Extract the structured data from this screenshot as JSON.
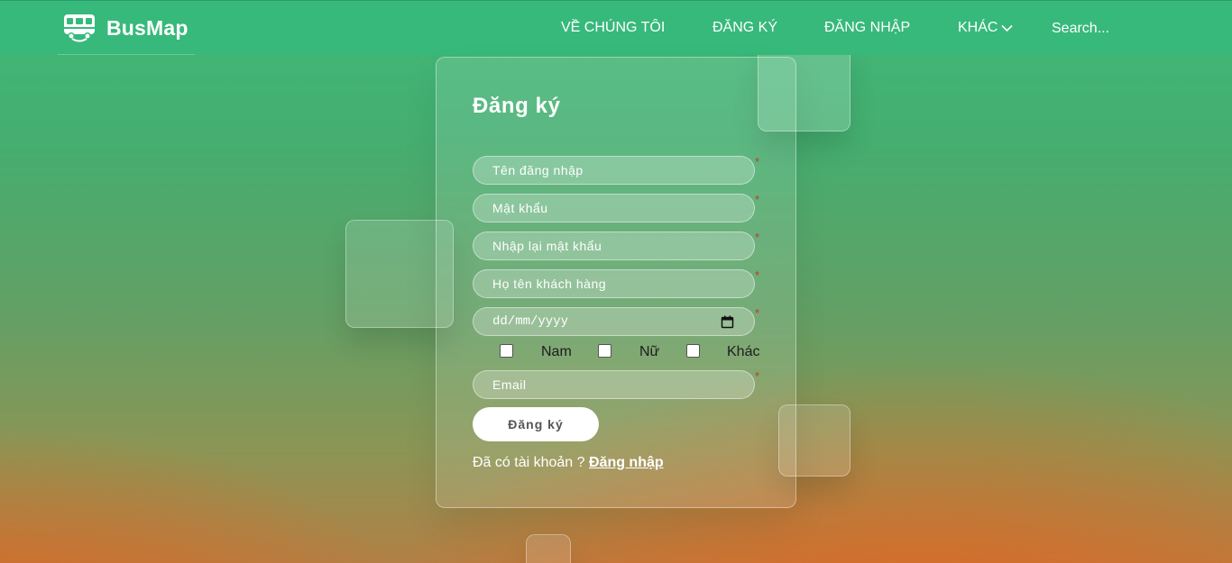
{
  "header": {
    "brand": "BusMap",
    "nav": {
      "about": "VỀ CHÚNG TÔI",
      "register": "ĐĂNG KÝ",
      "login": "ĐĂNG NHẬP",
      "more": "KHÁC"
    },
    "search_placeholder": "Search..."
  },
  "form": {
    "title": "Đăng ký",
    "fields": {
      "username": "Tên đăng nhập",
      "password": "Mật khẩu",
      "confirm_password": "Nhập lại mật khẩu",
      "full_name": "Họ tên khách hàng",
      "date": "dd/mm/yyyy",
      "email": "Email"
    },
    "required_mark": "*",
    "gender": {
      "male": "Nam",
      "female": "Nữ",
      "other": "Khác"
    },
    "submit": "Đăng ký",
    "have_account": "Đã có tài khoản ?",
    "login_link": "Đăng nhập"
  },
  "colors": {
    "nav_bg": "#37b97b",
    "required": "#c0392b"
  },
  "icons": {
    "brand": "bus-icon",
    "more": "chevron-down-icon",
    "date": "calendar-icon"
  }
}
